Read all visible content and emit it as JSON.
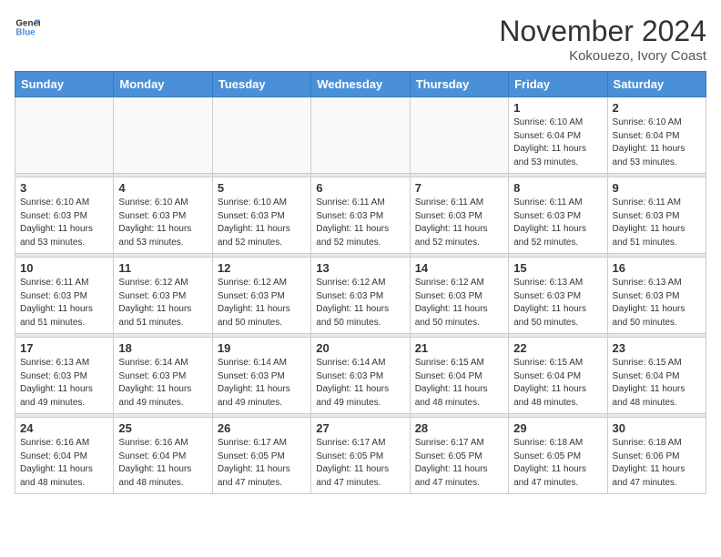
{
  "header": {
    "logo_general": "General",
    "logo_blue": "Blue",
    "title": "November 2024",
    "location": "Kokouezo, Ivory Coast"
  },
  "weekdays": [
    "Sunday",
    "Monday",
    "Tuesday",
    "Wednesday",
    "Thursday",
    "Friday",
    "Saturday"
  ],
  "weeks": [
    [
      {
        "day": "",
        "info": ""
      },
      {
        "day": "",
        "info": ""
      },
      {
        "day": "",
        "info": ""
      },
      {
        "day": "",
        "info": ""
      },
      {
        "day": "",
        "info": ""
      },
      {
        "day": "1",
        "info": "Sunrise: 6:10 AM\nSunset: 6:04 PM\nDaylight: 11 hours\nand 53 minutes."
      },
      {
        "day": "2",
        "info": "Sunrise: 6:10 AM\nSunset: 6:04 PM\nDaylight: 11 hours\nand 53 minutes."
      }
    ],
    [
      {
        "day": "3",
        "info": "Sunrise: 6:10 AM\nSunset: 6:03 PM\nDaylight: 11 hours\nand 53 minutes."
      },
      {
        "day": "4",
        "info": "Sunrise: 6:10 AM\nSunset: 6:03 PM\nDaylight: 11 hours\nand 53 minutes."
      },
      {
        "day": "5",
        "info": "Sunrise: 6:10 AM\nSunset: 6:03 PM\nDaylight: 11 hours\nand 52 minutes."
      },
      {
        "day": "6",
        "info": "Sunrise: 6:11 AM\nSunset: 6:03 PM\nDaylight: 11 hours\nand 52 minutes."
      },
      {
        "day": "7",
        "info": "Sunrise: 6:11 AM\nSunset: 6:03 PM\nDaylight: 11 hours\nand 52 minutes."
      },
      {
        "day": "8",
        "info": "Sunrise: 6:11 AM\nSunset: 6:03 PM\nDaylight: 11 hours\nand 52 minutes."
      },
      {
        "day": "9",
        "info": "Sunrise: 6:11 AM\nSunset: 6:03 PM\nDaylight: 11 hours\nand 51 minutes."
      }
    ],
    [
      {
        "day": "10",
        "info": "Sunrise: 6:11 AM\nSunset: 6:03 PM\nDaylight: 11 hours\nand 51 minutes."
      },
      {
        "day": "11",
        "info": "Sunrise: 6:12 AM\nSunset: 6:03 PM\nDaylight: 11 hours\nand 51 minutes."
      },
      {
        "day": "12",
        "info": "Sunrise: 6:12 AM\nSunset: 6:03 PM\nDaylight: 11 hours\nand 50 minutes."
      },
      {
        "day": "13",
        "info": "Sunrise: 6:12 AM\nSunset: 6:03 PM\nDaylight: 11 hours\nand 50 minutes."
      },
      {
        "day": "14",
        "info": "Sunrise: 6:12 AM\nSunset: 6:03 PM\nDaylight: 11 hours\nand 50 minutes."
      },
      {
        "day": "15",
        "info": "Sunrise: 6:13 AM\nSunset: 6:03 PM\nDaylight: 11 hours\nand 50 minutes."
      },
      {
        "day": "16",
        "info": "Sunrise: 6:13 AM\nSunset: 6:03 PM\nDaylight: 11 hours\nand 50 minutes."
      }
    ],
    [
      {
        "day": "17",
        "info": "Sunrise: 6:13 AM\nSunset: 6:03 PM\nDaylight: 11 hours\nand 49 minutes."
      },
      {
        "day": "18",
        "info": "Sunrise: 6:14 AM\nSunset: 6:03 PM\nDaylight: 11 hours\nand 49 minutes."
      },
      {
        "day": "19",
        "info": "Sunrise: 6:14 AM\nSunset: 6:03 PM\nDaylight: 11 hours\nand 49 minutes."
      },
      {
        "day": "20",
        "info": "Sunrise: 6:14 AM\nSunset: 6:03 PM\nDaylight: 11 hours\nand 49 minutes."
      },
      {
        "day": "21",
        "info": "Sunrise: 6:15 AM\nSunset: 6:04 PM\nDaylight: 11 hours\nand 48 minutes."
      },
      {
        "day": "22",
        "info": "Sunrise: 6:15 AM\nSunset: 6:04 PM\nDaylight: 11 hours\nand 48 minutes."
      },
      {
        "day": "23",
        "info": "Sunrise: 6:15 AM\nSunset: 6:04 PM\nDaylight: 11 hours\nand 48 minutes."
      }
    ],
    [
      {
        "day": "24",
        "info": "Sunrise: 6:16 AM\nSunset: 6:04 PM\nDaylight: 11 hours\nand 48 minutes."
      },
      {
        "day": "25",
        "info": "Sunrise: 6:16 AM\nSunset: 6:04 PM\nDaylight: 11 hours\nand 48 minutes."
      },
      {
        "day": "26",
        "info": "Sunrise: 6:17 AM\nSunset: 6:05 PM\nDaylight: 11 hours\nand 47 minutes."
      },
      {
        "day": "27",
        "info": "Sunrise: 6:17 AM\nSunset: 6:05 PM\nDaylight: 11 hours\nand 47 minutes."
      },
      {
        "day": "28",
        "info": "Sunrise: 6:17 AM\nSunset: 6:05 PM\nDaylight: 11 hours\nand 47 minutes."
      },
      {
        "day": "29",
        "info": "Sunrise: 6:18 AM\nSunset: 6:05 PM\nDaylight: 11 hours\nand 47 minutes."
      },
      {
        "day": "30",
        "info": "Sunrise: 6:18 AM\nSunset: 6:06 PM\nDaylight: 11 hours\nand 47 minutes."
      }
    ]
  ]
}
